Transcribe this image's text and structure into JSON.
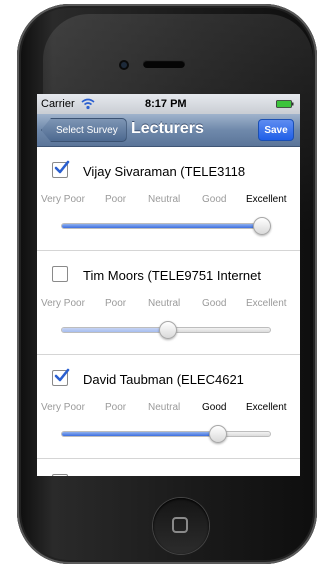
{
  "status_bar": {
    "carrier": "Carrier",
    "time": "8:17 PM"
  },
  "nav": {
    "back_label": "Select Survey",
    "title": "Lecturers",
    "save_label": "Save"
  },
  "rating_scale": [
    "Very Poor",
    "Poor",
    "Neutral",
    "Good",
    "Excellent"
  ],
  "lecturers": [
    {
      "name": "Vijay Sivaraman (TELE3118",
      "checked": true,
      "rating_index": 4,
      "slider_value": 1.0
    },
    {
      "name": "Tim Moors (TELE9751 Internet",
      "checked": false,
      "rating_index": -1,
      "slider_value": 0.5
    },
    {
      "name": "David Taubman (ELEC4621",
      "checked": true,
      "rating_index": 3,
      "slider_value": 0.75
    }
  ],
  "colors": {
    "accent": "#1f5fe8",
    "nav_bar": "#6f89ab",
    "slider_fill": "#3d6fe0"
  }
}
